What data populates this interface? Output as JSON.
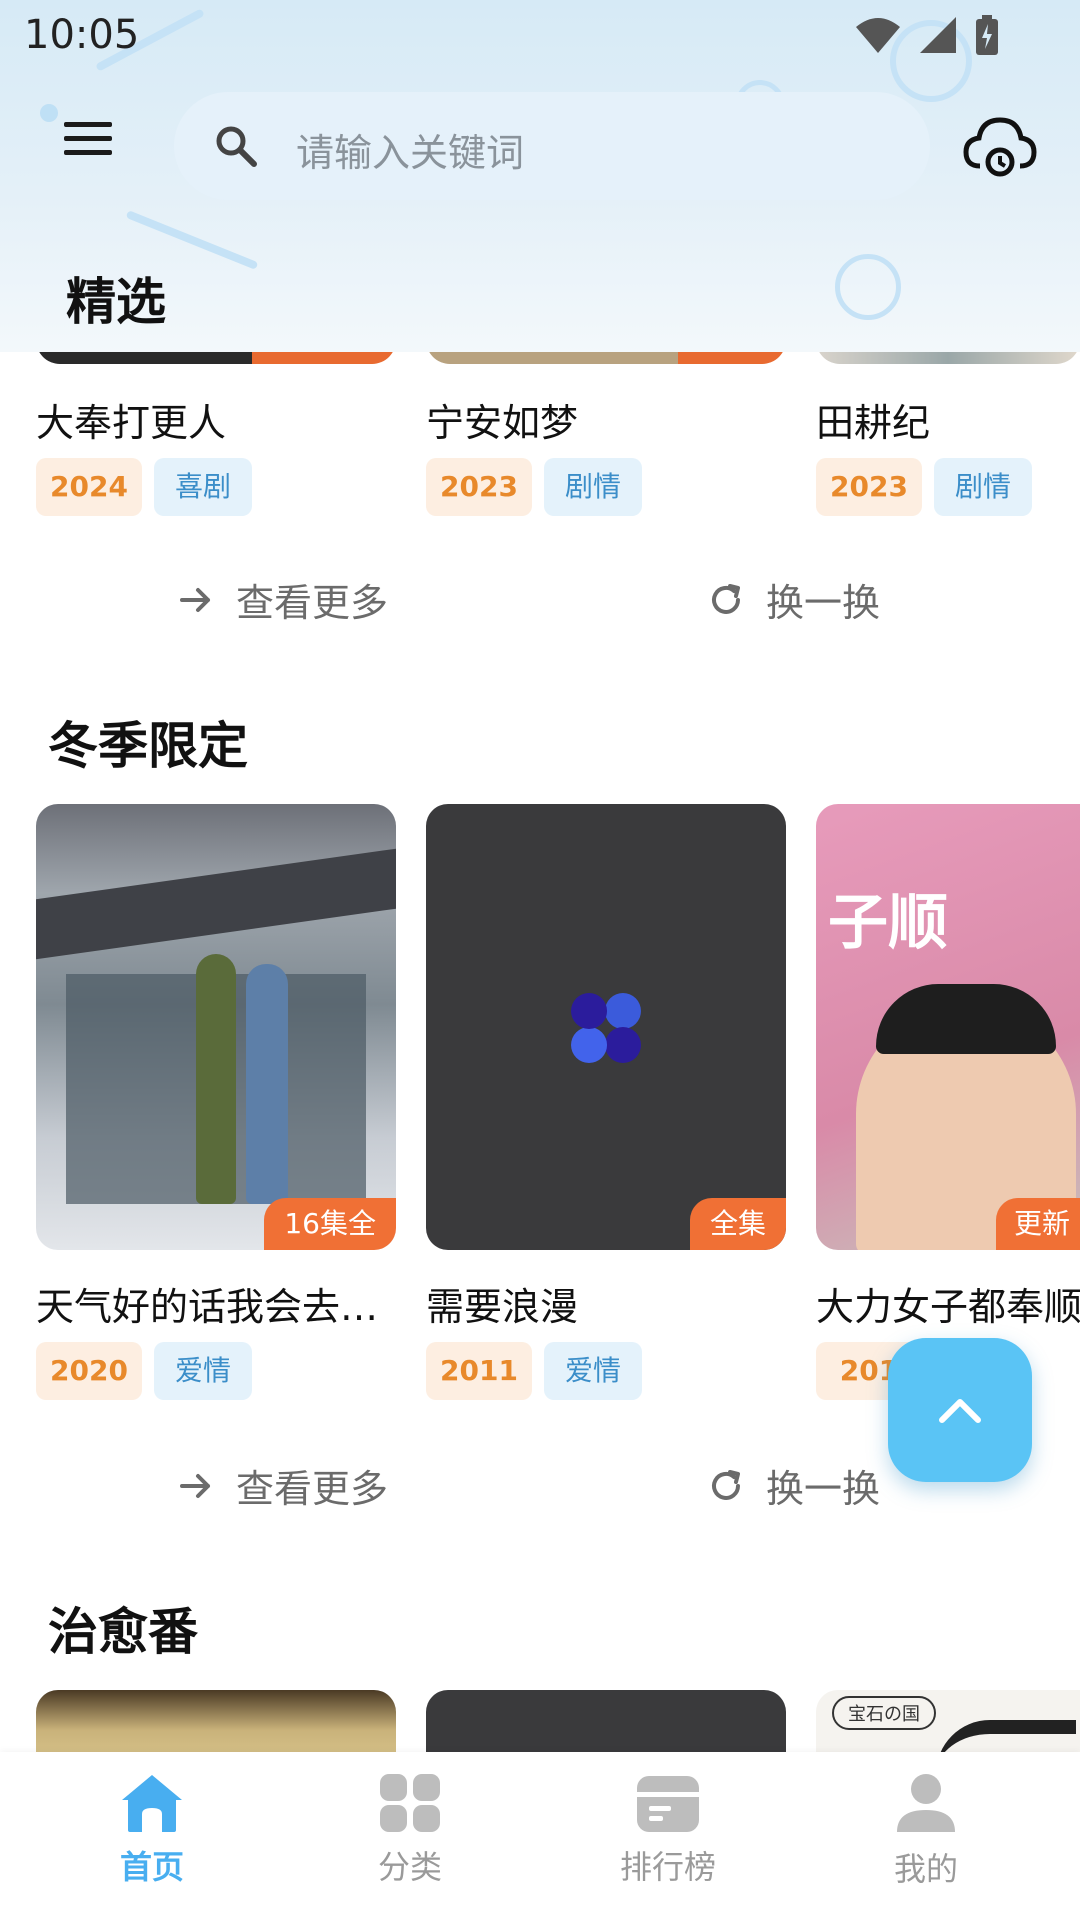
{
  "status_bar": {
    "time": "10:05"
  },
  "search": {
    "placeholder": "请输入关键词"
  },
  "header": {
    "title": "精选"
  },
  "featured": {
    "items": [
      {
        "title": "大奉打更人",
        "year": "2024",
        "genre": "喜剧"
      },
      {
        "title": "宁安如梦",
        "year": "2023",
        "genre": "剧情"
      },
      {
        "title": "田耕纪",
        "year": "2023",
        "genre": "剧情"
      }
    ],
    "more_label": "查看更多",
    "refresh_label": "换一换"
  },
  "winter": {
    "title": "冬季限定",
    "items": [
      {
        "title": "天气好的话我会去…",
        "year": "2020",
        "genre": "爱情",
        "badge": "16集全"
      },
      {
        "title": "需要浪漫",
        "year": "2011",
        "genre": "爱情",
        "badge": "全集"
      },
      {
        "title": "大力女子都奉顺",
        "year": "201",
        "genre": "",
        "badge": "更新"
      }
    ],
    "more_label": "查看更多",
    "refresh_label": "换一换"
  },
  "healing": {
    "title": "治愈番",
    "poster3_text": "宝石の国"
  },
  "poster_text": {
    "winter_card3": "子顺"
  },
  "bottom_nav": {
    "items": [
      {
        "label": "首页",
        "icon": "home-icon",
        "active": true
      },
      {
        "label": "分类",
        "icon": "grid-icon",
        "active": false
      },
      {
        "label": "排行榜",
        "icon": "ranking-icon",
        "active": false
      },
      {
        "label": "我的",
        "icon": "user-icon",
        "active": false
      }
    ]
  },
  "colors": {
    "accent": "#48aef0",
    "year_tag_text": "#e8892b",
    "genre_tag_text": "#3b8ec9",
    "badge": "#f07035",
    "fab": "#5ac4f5"
  }
}
